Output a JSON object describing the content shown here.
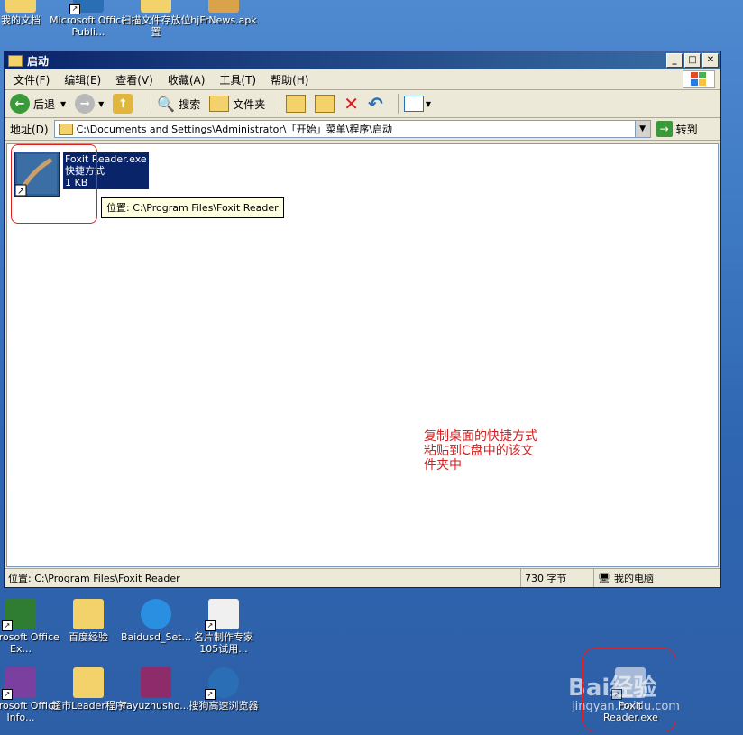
{
  "desktop": {
    "top_icons": [
      "我的文档",
      "Microsoft Office Publi...",
      "扫描文件存放位置",
      "hjFrNews.apk"
    ],
    "bottom_icons_row1": [
      "Microsoft Office Ex...",
      "百度经验",
      "Baidusd_Set...",
      "名片制作专家105试用..."
    ],
    "bottom_icons_row2": [
      "Microsoft Office Info...",
      "超市Leader程序",
      "fayuzhusho...",
      "搜狗高速浏览器"
    ],
    "corner_icon": "Foxit Reader.exe"
  },
  "window": {
    "title": "启动",
    "menu": [
      "文件(F)",
      "编辑(E)",
      "查看(V)",
      "收藏(A)",
      "工具(T)",
      "帮助(H)"
    ],
    "toolbar": {
      "back": "后退",
      "search": "搜索",
      "folders": "文件夹"
    },
    "address": {
      "label": "地址(D)",
      "path": "C:\\Documents and Settings\\Administrator\\「开始」菜单\\程序\\启动",
      "go": "转到"
    },
    "file": {
      "name": "Foxit Reader.exe",
      "type": "快捷方式",
      "size": "1 KB"
    },
    "tooltip": "位置: C:\\Program Files\\Foxit Reader",
    "status": {
      "location": "位置: C:\\Program Files\\Foxit Reader",
      "size": "730 字节",
      "computer": "我的电脑"
    }
  },
  "annotation": "复制桌面的快捷方式粘贴到C盘中的该文件夹中",
  "watermark": {
    "brand": "Bai经验",
    "url": "jingyan.baidu.com"
  },
  "colors": {
    "titlebar": "#0a246a",
    "annotation": "#d02020",
    "desktop": "#3e79c4"
  }
}
